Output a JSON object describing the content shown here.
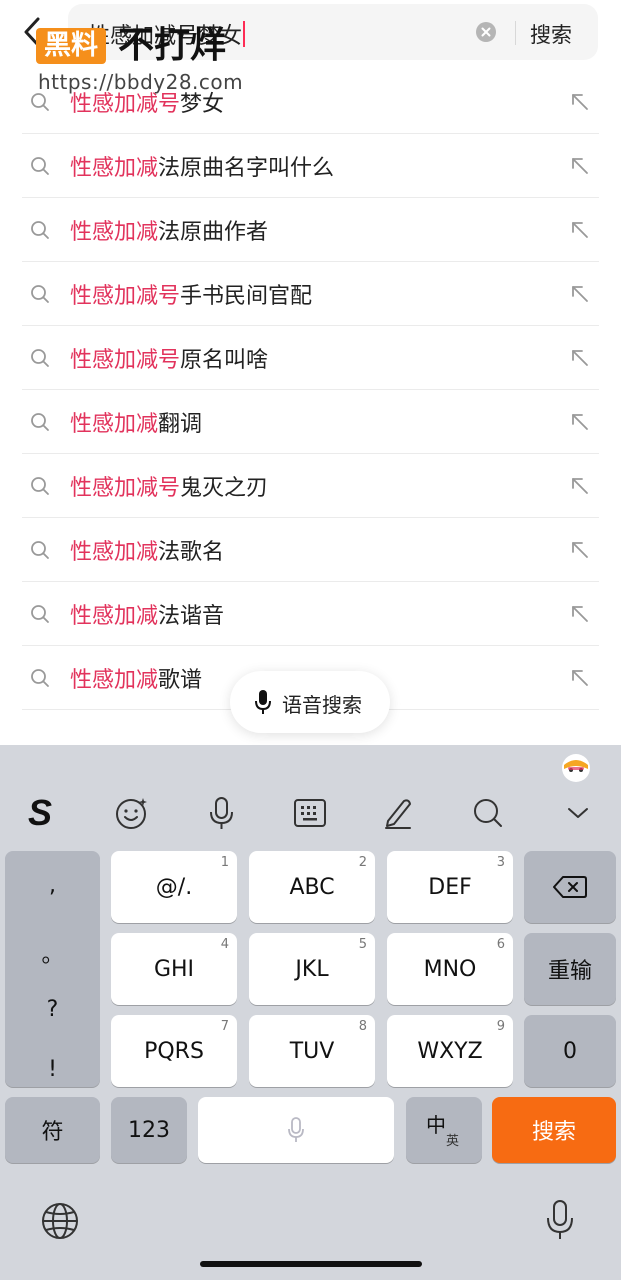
{
  "header": {
    "search_value": "性感加减号梦女",
    "search_button": "搜索"
  },
  "watermark": {
    "badge": "黑料",
    "text": "不打烊",
    "url": "https://bbdy28.com"
  },
  "suggestions": [
    {
      "highlight": "性感加减号",
      "rest": "梦女"
    },
    {
      "highlight": "性感加减",
      "rest": "法原曲名字叫什么"
    },
    {
      "highlight": "性感加减",
      "rest": "法原曲作者"
    },
    {
      "highlight": "性感加减号",
      "rest": "手书民间官配"
    },
    {
      "highlight": "性感加减号",
      "rest": "原名叫啥"
    },
    {
      "highlight": "性感加减",
      "rest": "翻调"
    },
    {
      "highlight": "性感加减号",
      "rest": "鬼灭之刃"
    },
    {
      "highlight": "性感加减",
      "rest": "法歌名"
    },
    {
      "highlight": "性感加减",
      "rest": "法谐音"
    },
    {
      "highlight": "性感加减",
      "rest": "歌谱"
    }
  ],
  "voice_search": {
    "label": "语音搜索"
  },
  "keyboard": {
    "toolbar_logo": "S",
    "punctuation": [
      ",",
      "。",
      "?",
      "!"
    ],
    "keys": {
      "k1": {
        "label": "@/.",
        "num": "1"
      },
      "k2": {
        "label": "ABC",
        "num": "2"
      },
      "k3": {
        "label": "DEF",
        "num": "3"
      },
      "k4": {
        "label": "GHI",
        "num": "4"
      },
      "k5": {
        "label": "JKL",
        "num": "5"
      },
      "k6": {
        "label": "MNO",
        "num": "6"
      },
      "k7": {
        "label": "PQRS",
        "num": "7"
      },
      "k8": {
        "label": "TUV",
        "num": "8"
      },
      "k9": {
        "label": "WXYZ",
        "num": "9"
      }
    },
    "retype": "重输",
    "zero": "0",
    "symbols": "符",
    "numbers": "123",
    "lang_main": "中",
    "lang_alt": "英",
    "submit": "搜索"
  },
  "colors": {
    "highlight": "#e2335c",
    "accent": "#f76b12",
    "keyboard_bg": "#d3d6dc"
  }
}
